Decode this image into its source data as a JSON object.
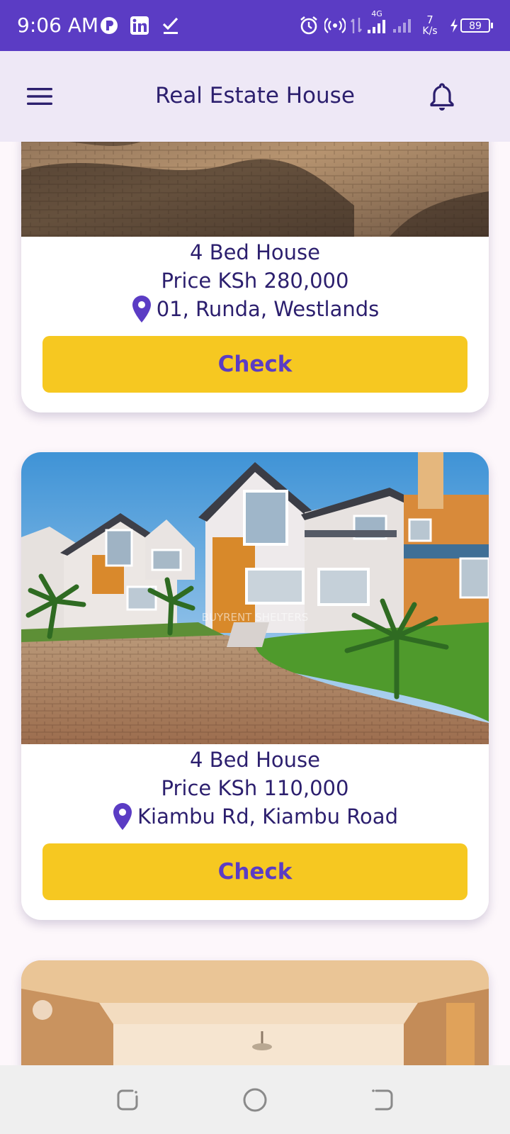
{
  "status_bar": {
    "time": "9:06 AM",
    "network_type": "4G",
    "speed_value": "7",
    "speed_unit": "K/s",
    "battery": "89",
    "icons": [
      "app-p-icon",
      "linkedin-icon",
      "check-icon",
      "alarm-icon",
      "hotspot-icon",
      "data-arrows-icon",
      "signal-icon",
      "signal-icon",
      "charging-icon",
      "battery-icon"
    ]
  },
  "app_bar": {
    "title": "Real Estate House",
    "menu_icon": "hamburger-menu-icon",
    "notification_icon": "bell-icon"
  },
  "listings": [
    {
      "title": "4 Bed House",
      "price": "Price KSh 280,000",
      "location": "01, Runda, Westlands",
      "button_label": "Check"
    },
    {
      "title": "4 Bed House",
      "price": "Price KSh 110,000",
      "location": "Kiambu Rd, Kiambu Road",
      "button_label": "Check",
      "photo_watermark": "BUYRENT SHELTERS"
    },
    {}
  ],
  "colors": {
    "primary": "#5b3cc4",
    "app_bar_bg": "#eee8f6",
    "text_dark": "#2c1f6e",
    "button_yellow": "#f6c821",
    "page_bg": "#fdf7fb"
  },
  "nav_bar": {
    "buttons": [
      "recents-icon",
      "home-icon",
      "back-icon"
    ]
  }
}
